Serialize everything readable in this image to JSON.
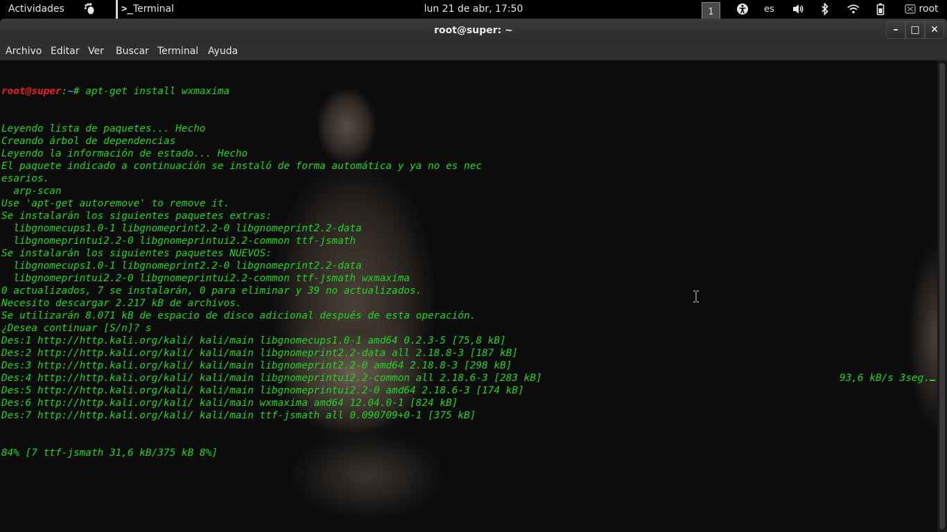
{
  "topbar": {
    "activities": "Actividades",
    "app_name": "Terminal",
    "app_prompt_glyph": ">_",
    "clock": "lun 21 de abr, 17:50",
    "workspace": "1",
    "language": "es",
    "user": "root",
    "icons": [
      "gnome-foot-icon",
      "accessibility-icon",
      "volume-icon",
      "bluetooth-icon",
      "wifi-icon",
      "battery-icon",
      "user-icon"
    ]
  },
  "window": {
    "title": "root@super: ~",
    "buttons": {
      "minimize": "–",
      "maximize": "□",
      "close": "✕"
    }
  },
  "menubar": {
    "items": [
      "Archivo",
      "Editar",
      "Ver",
      "Buscar",
      "Terminal",
      "Ayuda"
    ]
  },
  "terminal": {
    "prompt_user": "root@super",
    "prompt_colon": ":",
    "prompt_path": "~",
    "prompt_command": "# apt-get install wxmaxima",
    "lines": [
      "Leyendo lista de paquetes... Hecho",
      "Creando árbol de dependencias",
      "Leyendo la información de estado... Hecho",
      "El paquete indicado a continuación se instaló de forma automática y ya no es nec",
      "esarios.",
      "  arp-scan",
      "Use 'apt-get autoremove' to remove it.",
      "Se instalarán los siguientes paquetes extras:",
      "  libgnomecups1.0-1 libgnomeprint2.2-0 libgnomeprint2.2-data",
      "  libgnomeprintui2.2-0 libgnomeprintui2.2-common ttf-jsmath",
      "Se instalarán los siguientes paquetes NUEVOS:",
      "  libgnomecups1.0-1 libgnomeprint2.2-0 libgnomeprint2.2-data",
      "  libgnomeprintui2.2-0 libgnomeprintui2.2-common ttf-jsmath wxmaxima",
      "0 actualizados, 7 se instalarán, 0 para eliminar y 39 no actualizados.",
      "Necesito descargar 2.217 kB de archivos.",
      "Se utilizarán 8.071 kB de espacio de disco adicional después de esta operación.",
      "¿Desea continuar [S/n]? s",
      "Des:1 http://http.kali.org/kali/ kali/main libgnomecups1.0-1 amd64 0.2.3-5 [75,8 kB]",
      "Des:2 http://http.kali.org/kali/ kali/main libgnomeprint2.2-data all 2.18.8-3 [187 kB]",
      "Des:3 http://http.kali.org/kali/ kali/main libgnomeprint2.2-0 amd64 2.18.8-3 [298 kB]",
      "Des:4 http://http.kali.org/kali/ kali/main libgnomeprintui2.2-common all 2.18.6-3 [283 kB]",
      "Des:5 http://http.kali.org/kali/ kali/main libgnomeprintui2.2-0 amd64 2.18.6-3 [174 kB]",
      "Des:6 http://http.kali.org/kali/ kali/main wxmaxima amd64 12.04.0-1 [824 kB]",
      "Des:7 http://http.kali.org/kali/ kali/main ttf-jsmath all 0.090709+0-1 [375 kB]"
    ],
    "progress_left": "84% [7 ttf-jsmath 31,6 kB/375 kB 8%]",
    "progress_right": "93,6 kB/s 3seg.",
    "colors": {
      "text": "#25d425",
      "user": "#e8222a",
      "path": "#3b8bff",
      "background": "#0c0c0c"
    }
  }
}
